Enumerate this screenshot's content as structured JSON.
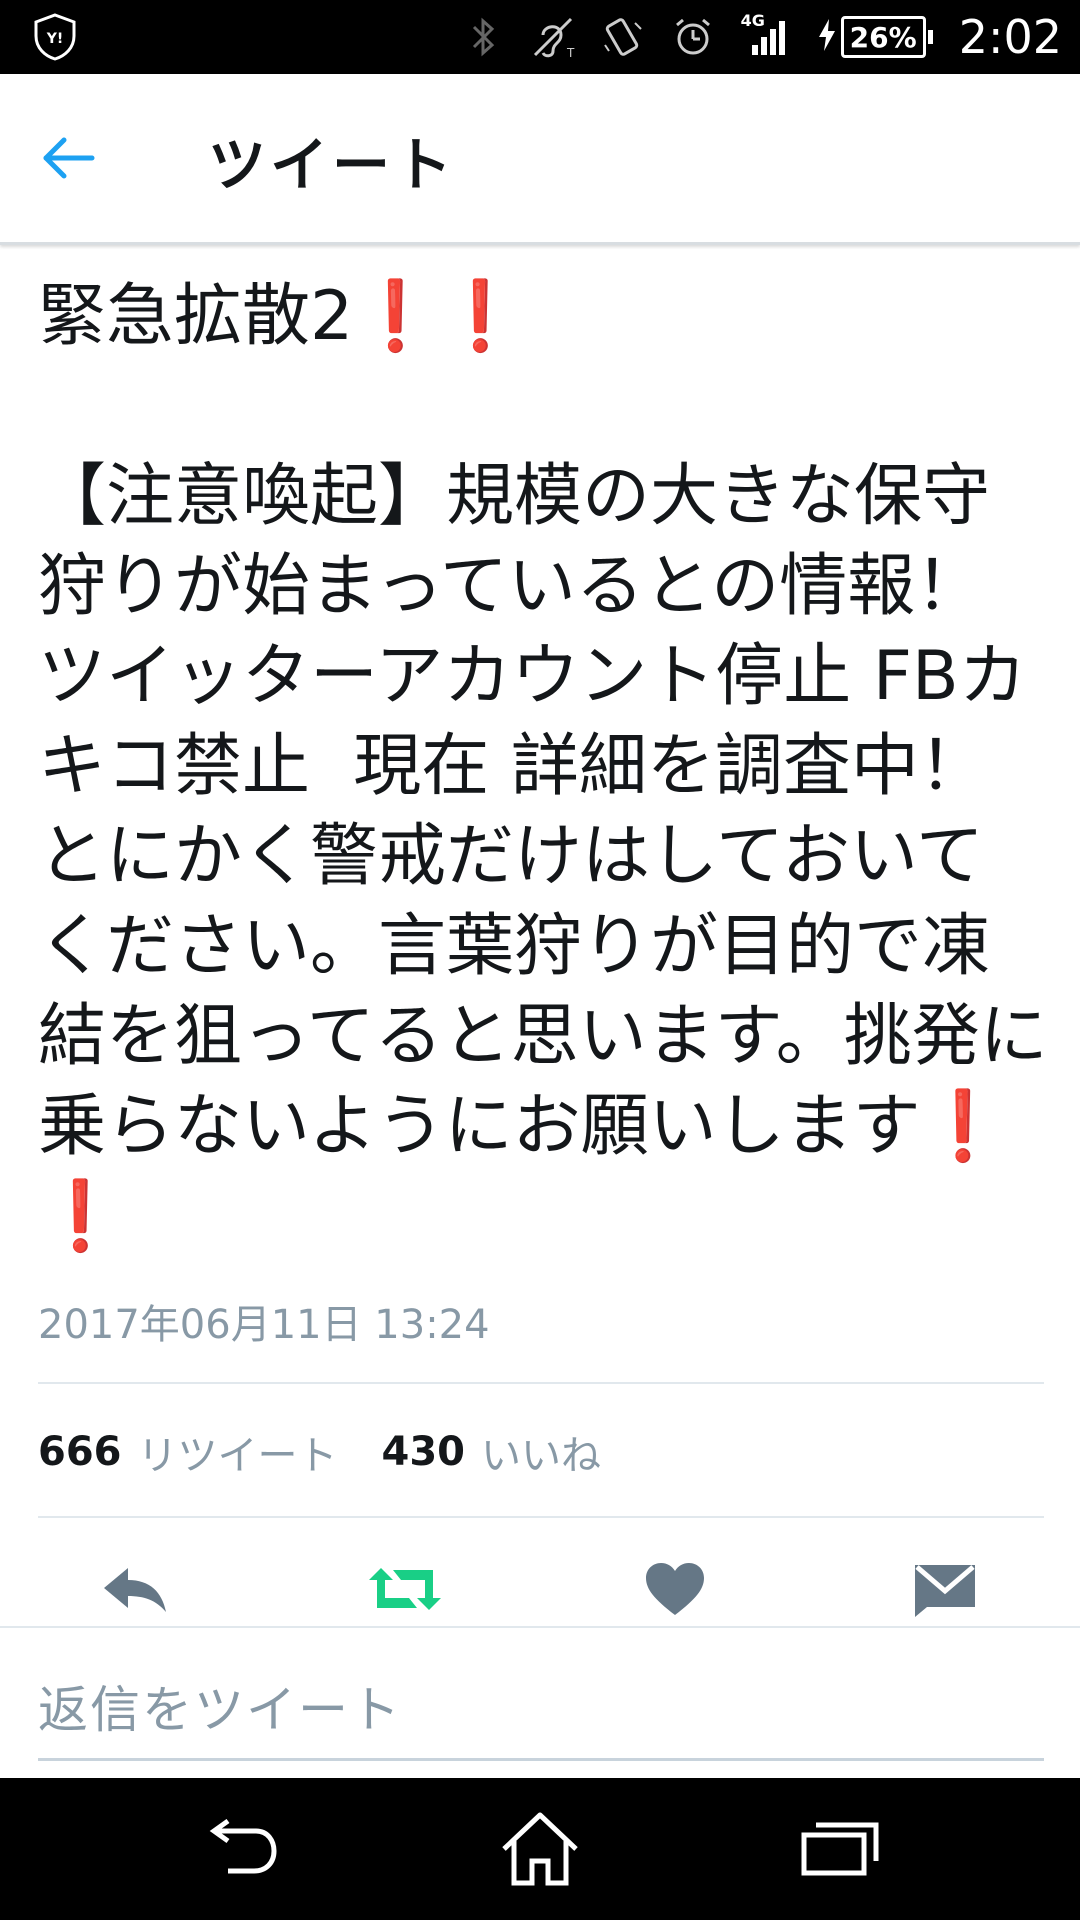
{
  "status_bar": {
    "network": "4G",
    "battery": "26%",
    "time": "2:02"
  },
  "header": {
    "title": "ツイート"
  },
  "tweet": {
    "title_text": "緊急拡散2",
    "body_text": "【注意喚起】規模の大きな保守狩りが始まっているとの情報！ ツイッターアカウント停止 FBカキコ禁止  現在 詳細を調査中！とにかく警戒だけはしておいてください。言葉狩りが目的で凍結を狙ってると思います。挑発に乗らないようにお願いします",
    "exclamation": "❗",
    "timestamp": "2017年06月11日 13:24"
  },
  "stats": {
    "retweet_count": "666",
    "retweet_label": "リツイート",
    "like_count": "430",
    "like_label": "いいね"
  },
  "reply": {
    "placeholder": "返信をツイート"
  },
  "colors": {
    "twitter_blue": "#1da1f2",
    "retweet_green": "#19cf86",
    "icon_gray": "#657786",
    "exclamation_red": "#e8311e"
  }
}
